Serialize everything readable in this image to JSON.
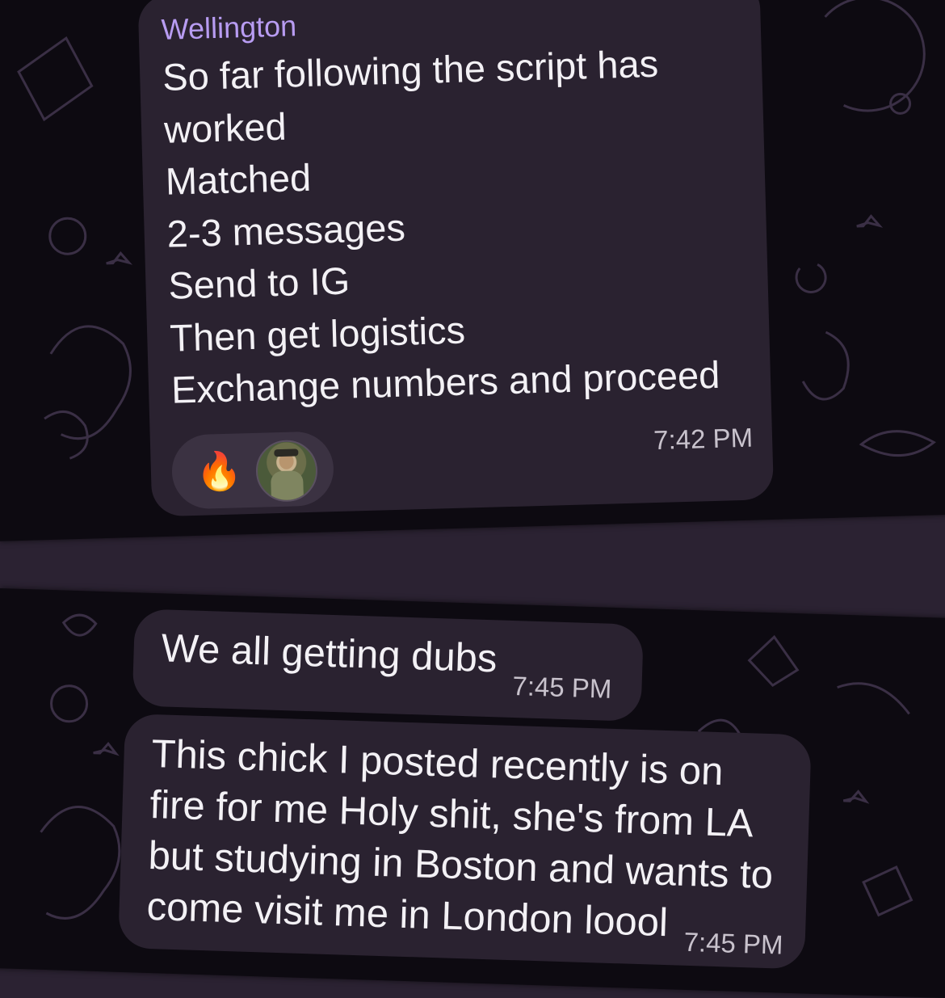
{
  "colors": {
    "background": "#2b2232",
    "chat_background": "#0d0a11",
    "bubble": "#2a2230",
    "sender_name": "#b89cf2",
    "text": "#f3f1f5",
    "timestamp": "#c8c2cc",
    "reaction_pill": "#3b3242"
  },
  "top_message": {
    "sender": "Wellington",
    "lines": [
      "So far following the script has",
      "worked",
      "Matched",
      "2-3 messages",
      "Send to IG",
      "Then get logistics",
      "Exchange numbers and proceed"
    ],
    "reactions": {
      "emoji": "🔥",
      "reactor_icon": "user-avatar-icon"
    },
    "time": "7:42 PM"
  },
  "bottom_messages": [
    {
      "text": "We all getting dubs",
      "time": "7:45 PM"
    },
    {
      "lines": [
        "This chick I posted recently is on",
        "fire for me Holy shit, she's from LA",
        "but studying in Boston and wants to",
        "come visit me in London loool"
      ],
      "time": "7:45 PM"
    }
  ]
}
